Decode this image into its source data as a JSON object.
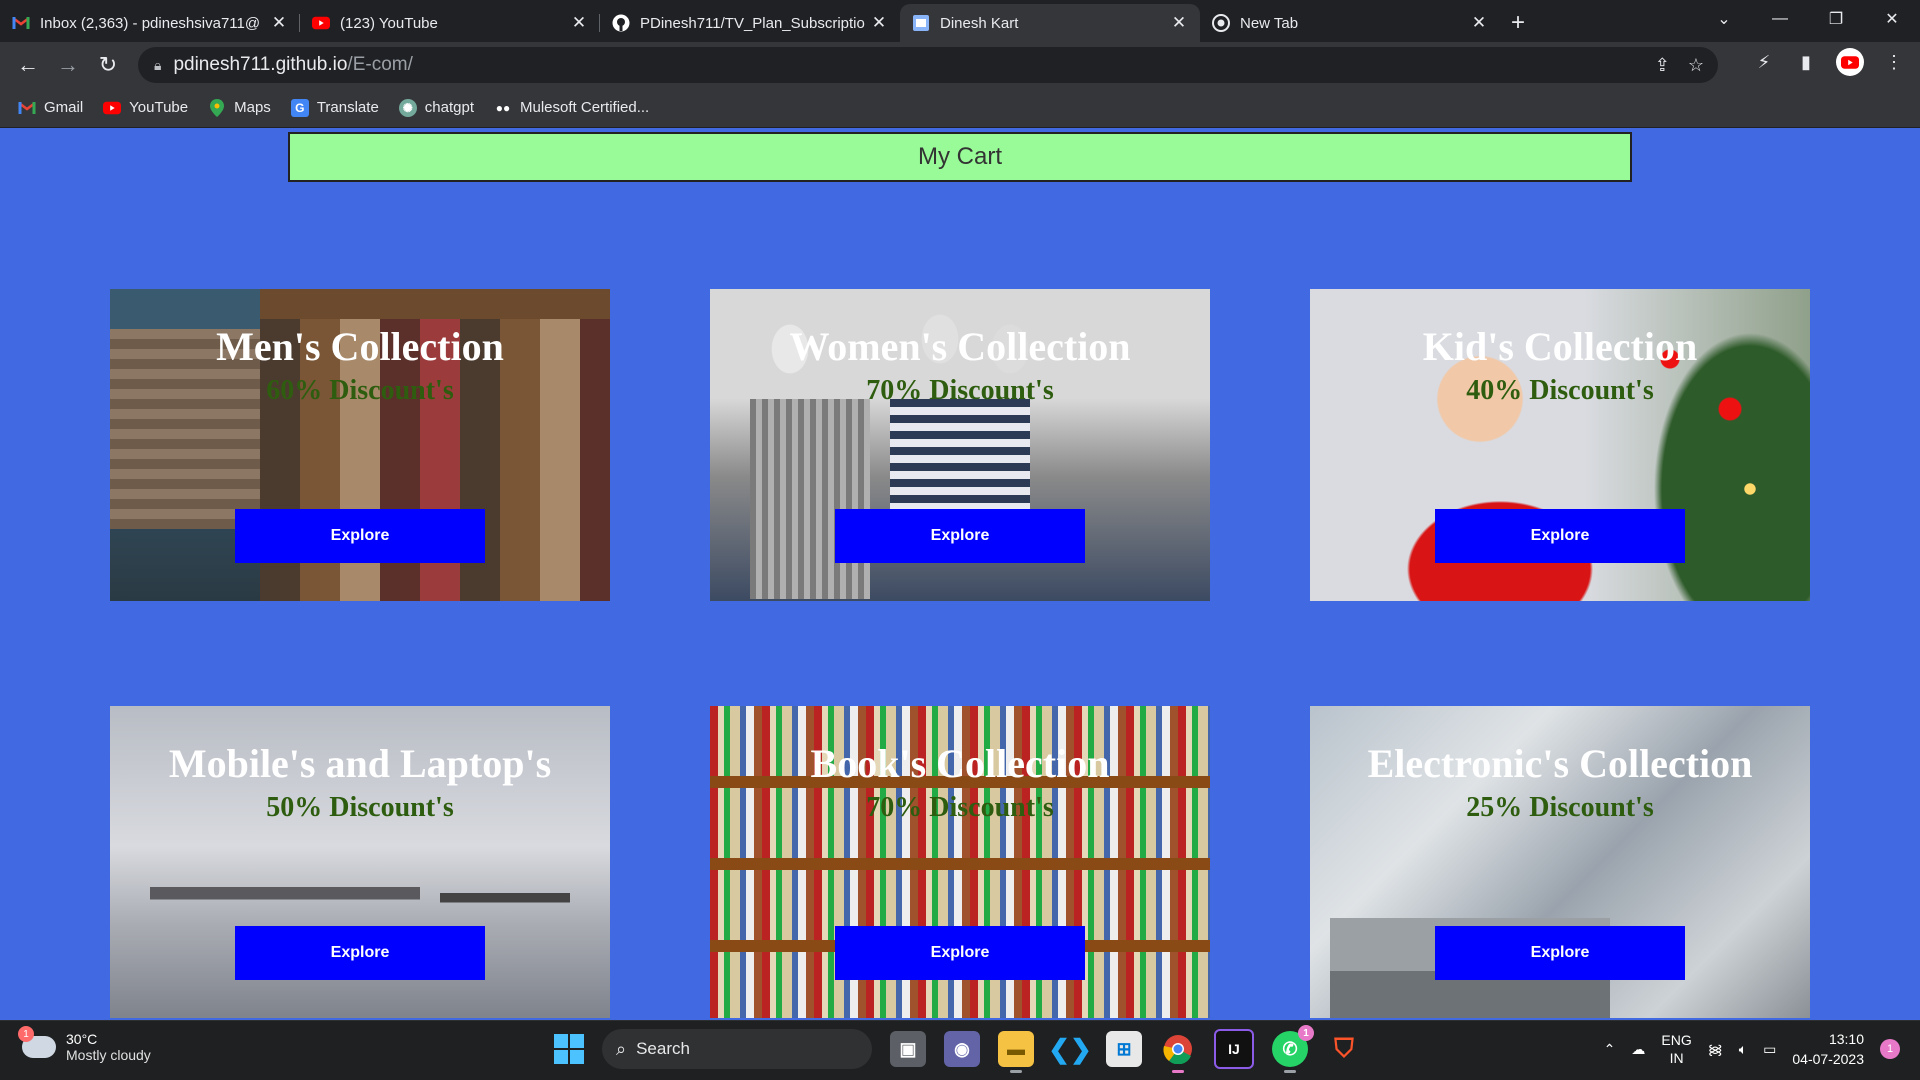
{
  "browser": {
    "tabs": [
      {
        "title": "Inbox (2,363) - pdineshsiva711@",
        "icon": "gmail-icon"
      },
      {
        "title": "(123) YouTube",
        "icon": "youtube-icon"
      },
      {
        "title": "PDinesh711/TV_Plan_Subscriptio",
        "icon": "github-icon"
      },
      {
        "title": "Dinesh Kart",
        "icon": "page-icon",
        "active": true
      },
      {
        "title": "New Tab",
        "icon": "chrome-icon"
      }
    ],
    "url_host": "pdinesh711.github.io",
    "url_path": "/E-com/",
    "bookmarks": [
      {
        "label": "Gmail",
        "icon": "gmail-icon"
      },
      {
        "label": "YouTube",
        "icon": "youtube-icon"
      },
      {
        "label": "Maps",
        "icon": "maps-icon"
      },
      {
        "label": "Translate",
        "icon": "translate-icon"
      },
      {
        "label": "chatgpt",
        "icon": "chatgpt-icon"
      },
      {
        "label": "Mulesoft Certified...",
        "icon": "medium-icon"
      }
    ]
  },
  "page": {
    "cart_label": "My Cart",
    "explore_label": "Explore",
    "cards": [
      {
        "title": "Men's Collection",
        "discount": "60% Discount's"
      },
      {
        "title": "Women's Collection",
        "discount": "70% Discount's"
      },
      {
        "title": "Kid's Collection",
        "discount": "40% Discount's"
      },
      {
        "title": "Mobile's and Laptop's",
        "discount": "50% Discount's"
      },
      {
        "title": "Book's Collection",
        "discount": "70% Discount's"
      },
      {
        "title": "Electronic's Collection",
        "discount": "25% Discount's"
      }
    ]
  },
  "taskbar": {
    "weather_temp": "30°C",
    "weather_desc": "Mostly cloudy",
    "weather_badge": "1",
    "search_label": "Search",
    "lang_1": "ENG",
    "lang_2": "IN",
    "time": "13:10",
    "date": "04-07-2023",
    "notification_count": "1",
    "whatsapp_badge": "1"
  }
}
